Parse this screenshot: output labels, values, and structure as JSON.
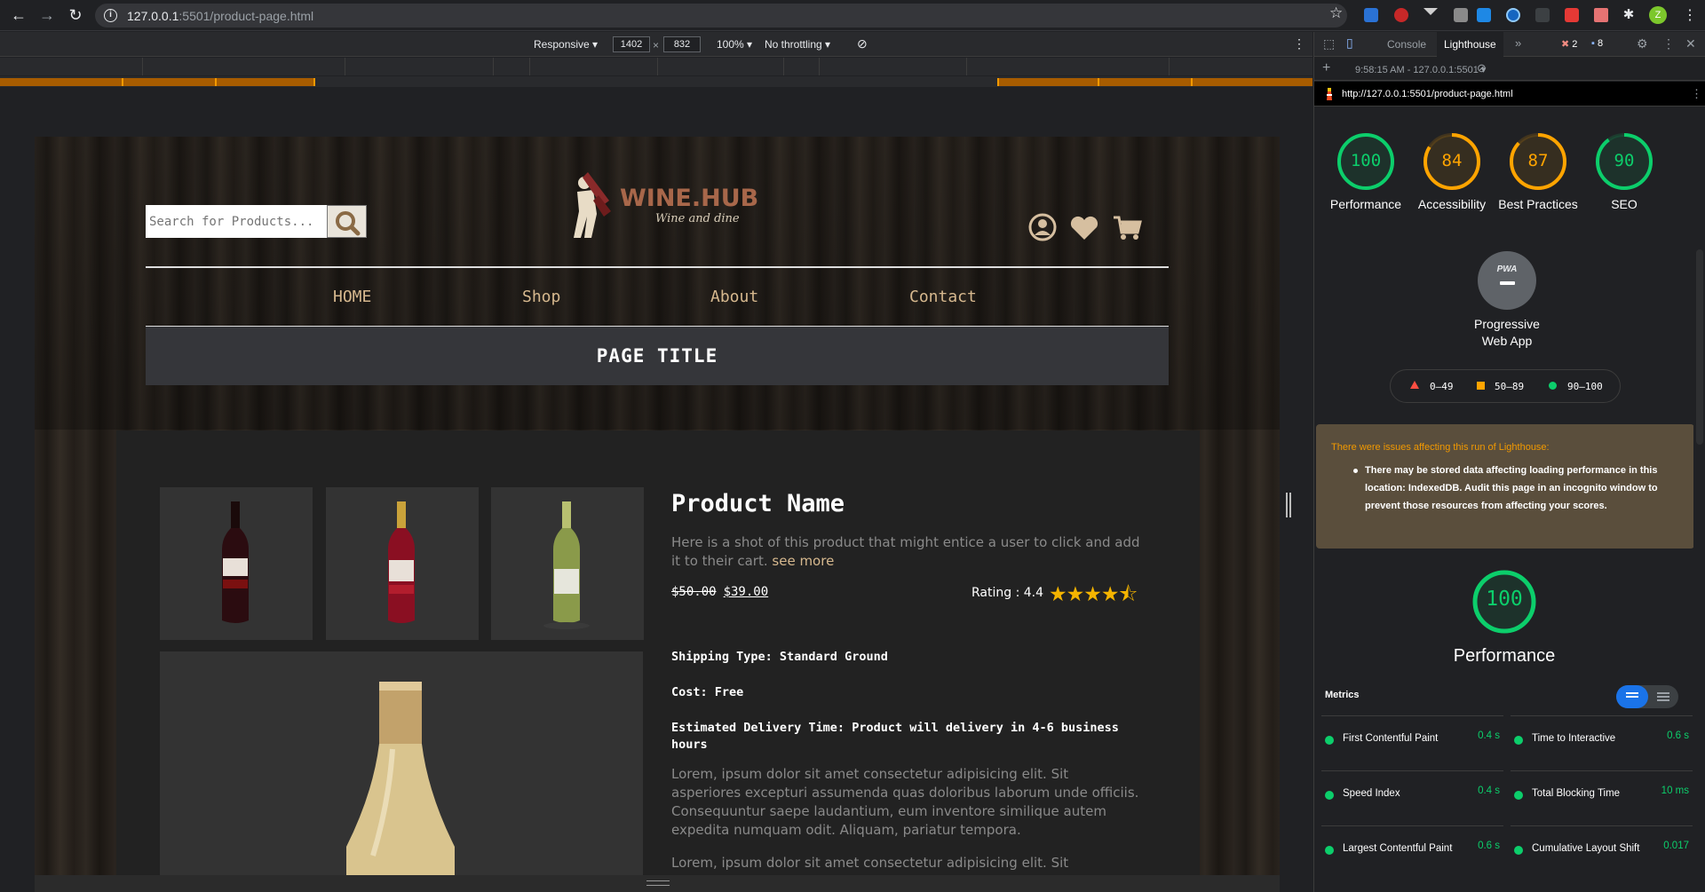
{
  "browser": {
    "url_host": "127.0.0.1",
    "url_path": ":5501/product-page.html",
    "profile_initial": "Z"
  },
  "device_toolbar": {
    "device": "Responsive",
    "width": "1402",
    "x_sep": "×",
    "height": "832",
    "zoom": "100%",
    "throttling": "No throttling"
  },
  "site": {
    "search_placeholder": "Search for Products...",
    "logo_text": "WINE.HUB",
    "logo_sub": "Wine and dine",
    "nav": [
      "HOME",
      "Shop",
      "About",
      "Contact"
    ],
    "page_title": "PAGE TITLE",
    "product": {
      "name": "Product Name",
      "description": "Here is a shot of this product that might entice a user to click and add it to their cart.",
      "see_more": "see more",
      "old_price": "$50.00",
      "new_price": "$39.00",
      "rating_label": "Rating : 4.4",
      "rating_value": 4.4,
      "stars": "★★★★",
      "half_star": "⯪",
      "shipping_type": "Shipping Type: Standard Ground",
      "cost": "Cost: Free",
      "delivery": "Estimated Delivery Time: Product will delivery in 4-6 business hours",
      "lorem1": "Lorem, ipsum dolor sit amet consectetur adipisicing elit. Sit asperiores excepturi assumenda quas doloribus laborum unde officiis. Consequuntur saepe laudantium, eum inventore similique autem expedita numquam odit. Aliquam, pariatur tempora.",
      "lorem2": "Lorem, ipsum dolor sit amet consectetur adipisicing elit. Sit asperiores excepturi assumenda quas doloribus laborum unde officiis. Consequuntur"
    }
  },
  "devtools": {
    "tabs": [
      "Console",
      "Lighthouse",
      "»"
    ],
    "errors": "2",
    "messages": "8",
    "report_time": "9:58:15 AM - 127.0.0.1:5501",
    "report_url": "http://127.0.0.1:5501/product-page.html",
    "scores": [
      {
        "label": "Performance",
        "value": "100",
        "color": "#0cce6b"
      },
      {
        "label": "Accessibility",
        "value": "84",
        "color": "#ffa400"
      },
      {
        "label": "Best Practices",
        "value": "87",
        "color": "#ffa400"
      },
      {
        "label": "SEO",
        "value": "90",
        "color": "#0cce6b"
      }
    ],
    "pwa_badge": "PWA",
    "pwa_label": "Progressive Web App",
    "legend": [
      "0–49",
      "50–89",
      "90–100"
    ],
    "warning_title": "There were issues affecting this run of Lighthouse:",
    "warning_text": "There may be stored data affecting loading performance in this location: IndexedDB. Audit this page in an incognito window to prevent those resources from affecting your scores.",
    "perf_score": "100",
    "perf_label": "Performance",
    "metrics_title": "Metrics",
    "metrics": [
      {
        "name": "First Contentful Paint",
        "value": "0.4 s"
      },
      {
        "name": "Time to Interactive",
        "value": "0.6 s"
      },
      {
        "name": "Speed Index",
        "value": "0.4 s"
      },
      {
        "name": "Total Blocking Time",
        "value": "10 ms"
      },
      {
        "name": "Largest Contentful Paint",
        "value": "0.6 s"
      },
      {
        "name": "Cumulative Layout Shift",
        "value": "0.017"
      }
    ]
  }
}
